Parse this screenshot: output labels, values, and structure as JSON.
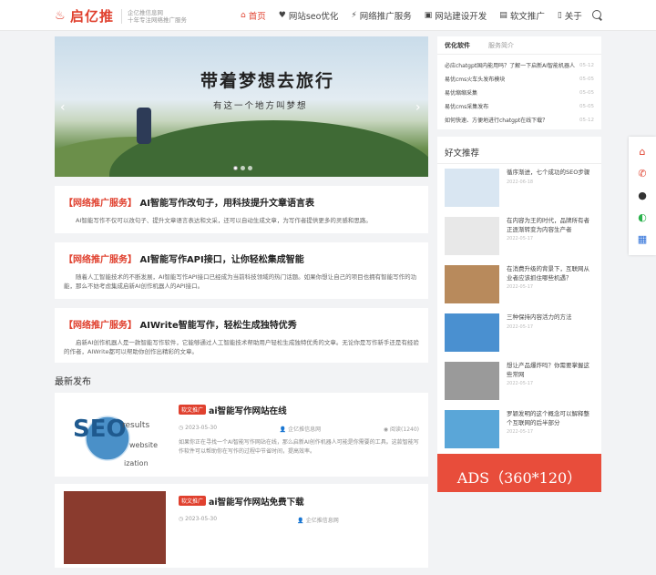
{
  "brand": {
    "name": "启亿推",
    "tagline1": "企亿推信息网",
    "tagline2": "十年专注网络推广服务",
    "color": "#e0412f"
  },
  "nav": [
    {
      "label": "首页",
      "icon": "home-icon",
      "active": true
    },
    {
      "label": "网站seo优化",
      "icon": "heart-icon"
    },
    {
      "label": "网络推广服务",
      "icon": "plug-icon"
    },
    {
      "label": "网站建设开发",
      "icon": "window-icon"
    },
    {
      "label": "软文推广",
      "icon": "money-icon"
    },
    {
      "label": "关于",
      "icon": "book-icon"
    }
  ],
  "slider": {
    "title": "带着梦想去旅行",
    "subtitle": "有这一个地方叫梦想"
  },
  "featured": [
    {
      "cat": "【网络推广服务】",
      "title": "AI智能写作改句子，用科技提升文章语言表",
      "desc": "AI智能写作不仅可以改句子、提升文章语言表达和文采，还可以自动生成文章，为写作者提供更多的灵感和思路。"
    },
    {
      "cat": "【网络推广服务】",
      "title": "AI智能写作API接口，让你轻松集成智能",
      "desc": "随着人工智能技术的不断发展，AI智能写作API接口已经成为当前科技领域的热门话题。如果你想让自己的项目也拥有智能写作的功能，那么不妨考虑集成启新AI创作机器人的API接口。"
    },
    {
      "cat": "【网络推广服务】",
      "title": "AIWrite智能写作，轻松生成独特优秀",
      "desc": "启新AI创作机器人是一款智能写作软件，它能够通过人工智能技术帮助用户轻松生成独特优秀的文章。无论你是写作新手还是有经验的作者，AIWrite都可以帮助你创作出精彩的文章。"
    }
  ],
  "latest": {
    "heading": "最新发布",
    "items": [
      {
        "badge": "软文推广",
        "title": "ai智能写作网站在线",
        "date": "2023-05-30",
        "author": "企亿推信息网",
        "reads": "阅读(1240)",
        "desc": "如果你正在寻找一个AI智能写作网站在线，那么启新AI创作机器人可能是你需要的工具。这款智能写作软件可以帮助你在写作的过程中节省时间，提高效率。"
      },
      {
        "badge": "软文推广",
        "title": "ai智能写作网站免费下载",
        "date": "2023-05-30",
        "author": "企亿推信息网"
      }
    ]
  },
  "sidebar": {
    "tabs": [
      "优化软件",
      "服务简介"
    ],
    "news": [
      {
        "title": "必应chatgpt国内能用吗？了解一下启新AI智能机器人",
        "date": "05-12"
      },
      {
        "title": "易优cms火车头发布模块",
        "date": "05-05"
      },
      {
        "title": "易优缩缩采集",
        "date": "05-05"
      },
      {
        "title": "易优cms采集发布",
        "date": "05-05"
      },
      {
        "title": "如何快速、方便地进行chatgpt在线下载？",
        "date": "05-12"
      }
    ],
    "recommend_title": "好文推荐",
    "recommend": [
      {
        "title": "循序渐进，七个成功的SEO步骤",
        "date": "2022-06-18"
      },
      {
        "title": "在内容为王的时代，品牌所有者正逐渐转变为内容生产者",
        "date": "2022-05-17"
      },
      {
        "title": "在消费升级的背景下，互联网从业者应该抓住哪些机遇？",
        "date": "2022-05-17"
      },
      {
        "title": "三种保持内容活力的方法",
        "date": "2022-05-17"
      },
      {
        "title": "想让产品爆炸吗？你需要掌握这些常网",
        "date": "2022-05-17"
      },
      {
        "title": "罗颖发明的这个概念可以解释整个互联网的后半部分",
        "date": "2022-05-17"
      }
    ]
  },
  "ads": {
    "text": "ADS（360*120）"
  },
  "floatbar": [
    "home-icon",
    "phone-icon",
    "qq-icon",
    "wechat-icon",
    "qrcode-icon"
  ]
}
